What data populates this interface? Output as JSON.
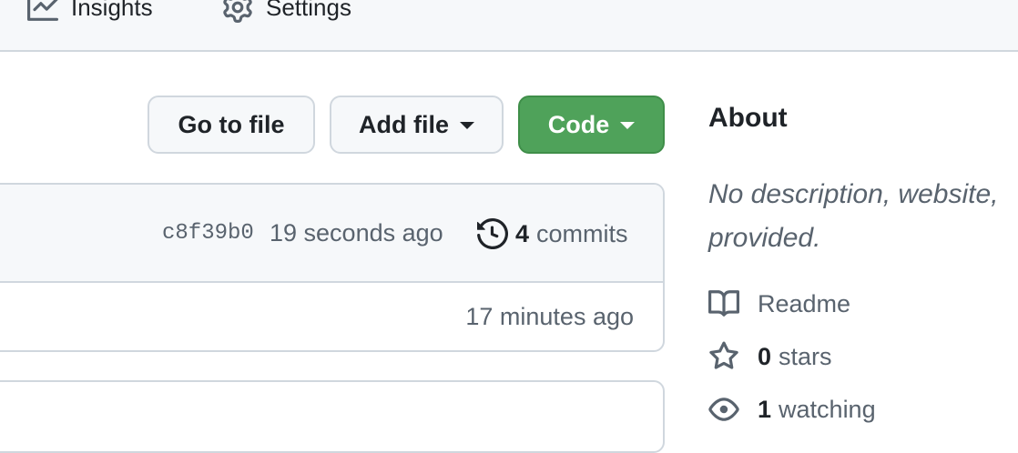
{
  "nav": {
    "insights": "Insights",
    "settings": "Settings"
  },
  "toolbar": {
    "go_to_file": "Go to file",
    "add_file": "Add file",
    "code": "Code"
  },
  "latest_commit": {
    "sha": "c8f39b0",
    "time": "19 seconds ago",
    "commits_count": "4",
    "commits_label": "commits"
  },
  "file_rows": [
    {
      "time": "17 minutes ago"
    }
  ],
  "about": {
    "title": "About",
    "description_line1": "No description, website,",
    "description_line2": "provided.",
    "readme": "Readme",
    "stars_count": "0",
    "stars_label": "stars",
    "watching_count": "1",
    "watching_label": "watching"
  },
  "colors": {
    "code_button": "#4fa25a",
    "border": "#d0d7de",
    "muted_text": "#59636e"
  },
  "icons": {
    "insights": "graph-icon",
    "settings": "gear-icon",
    "history": "history-icon",
    "readme": "book-icon",
    "stars": "star-icon",
    "watching": "eye-icon"
  }
}
